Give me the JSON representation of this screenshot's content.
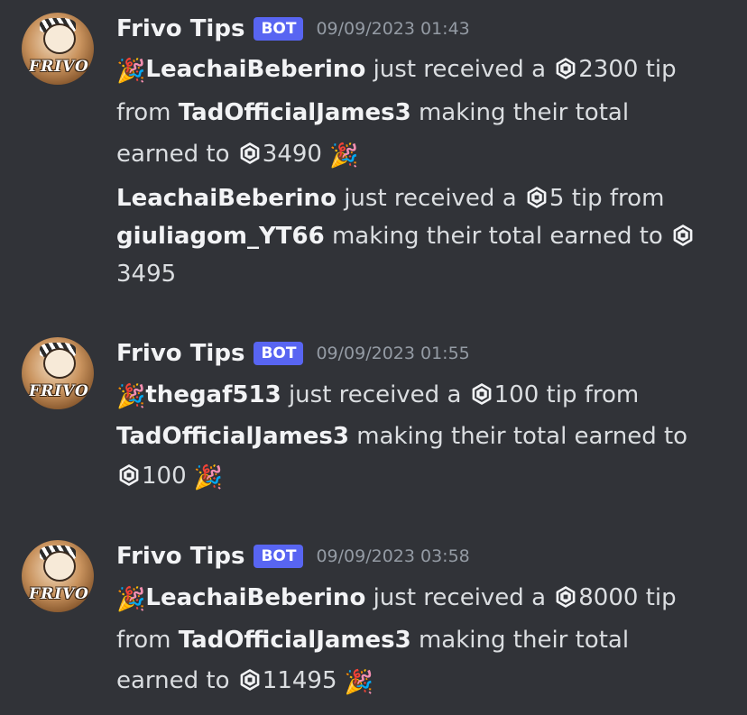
{
  "messages": [
    {
      "author": "Frivo Tips",
      "tag": "BOT",
      "timestamp": "09/09/2023 01:43",
      "avatar_text": "FRIVO",
      "lines": [
        {
          "user": "LeachaiBeberino",
          "t1": " just received a ",
          "amount": "2300",
          "t2": " tip",
          "from_word": "from ",
          "from_user": "TadOfficialJames3",
          "t3": " making their total",
          "t4": "earned to ",
          "total": "3490"
        },
        {
          "user": "LeachaiBeberino",
          "t1": " just received a ",
          "amount": "5",
          "t2": " tip from",
          "from_user": "giuliagom_YT66",
          "t3": " making their total earned to",
          "total": "3495"
        }
      ]
    },
    {
      "author": "Frivo Tips",
      "tag": "BOT",
      "timestamp": "09/09/2023 01:55",
      "avatar_text": "FRIVO",
      "lines": [
        {
          "user": "thegaf513",
          "t1": " just received a ",
          "amount": "100",
          "t2": " tip from",
          "from_user": "TadOfficialJames3",
          "t3": " making their total earned to",
          "total": "100"
        }
      ]
    },
    {
      "author": "Frivo Tips",
      "tag": "BOT",
      "timestamp": "09/09/2023 03:58",
      "avatar_text": "FRIVO",
      "lines": [
        {
          "user": "LeachaiBeberino",
          "t1": " just received a ",
          "amount": "8000",
          "t2": " tip",
          "from_word": "from ",
          "from_user": "TadOfficialJames3",
          "t3": " making their total",
          "t4": "earned to ",
          "total": "11495"
        }
      ]
    }
  ],
  "icons": {
    "currency": "robux-icon",
    "celebration": "party-popper-icon"
  },
  "colors": {
    "background": "#313338",
    "bot_tag": "#5865f2",
    "timestamp": "#949ba4",
    "text": "#dbdee1"
  }
}
